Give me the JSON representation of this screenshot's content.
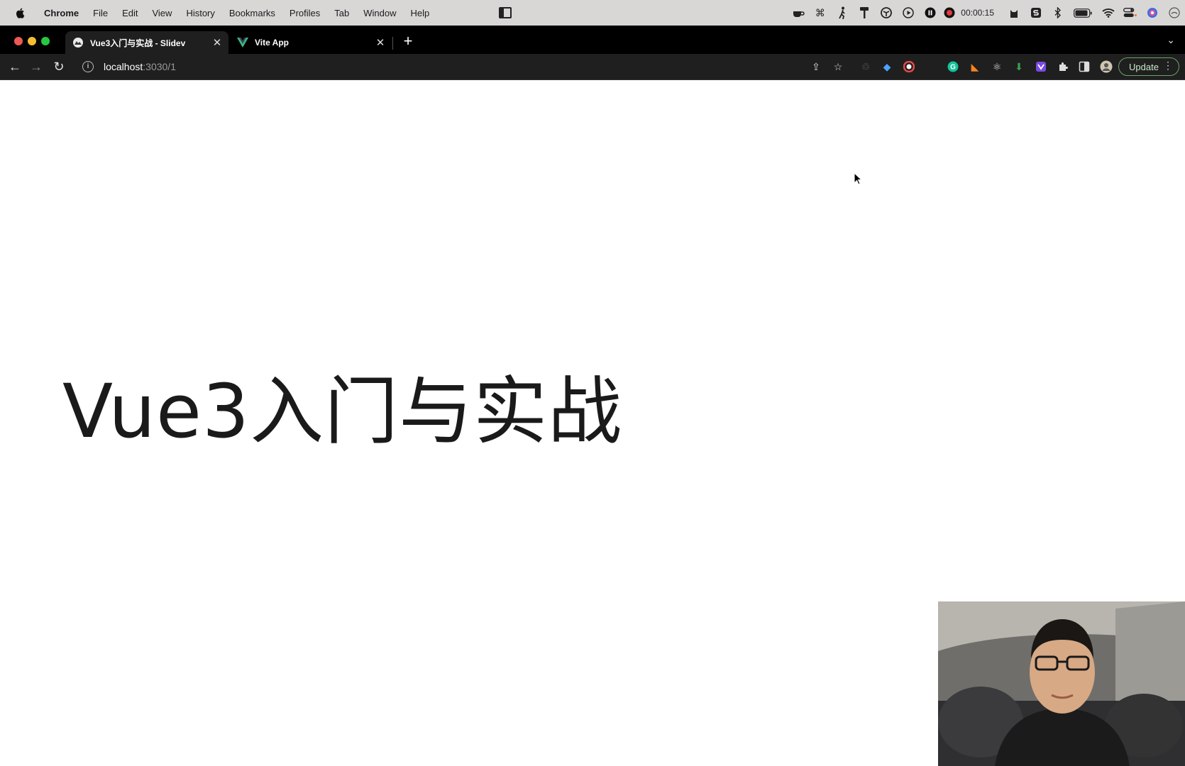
{
  "menubar": {
    "app_name": "Chrome",
    "items": [
      "File",
      "Edit",
      "View",
      "History",
      "Bookmarks",
      "Profiles",
      "Tab",
      "Window",
      "Help"
    ],
    "timer": "00:00:15"
  },
  "tabs": [
    {
      "title": "Vue3入门与实战 - Slidev",
      "active": true,
      "favicon": "slidev-icon"
    },
    {
      "title": "Vite App",
      "active": false,
      "favicon": "vue-icon"
    }
  ],
  "address_bar": {
    "host": "localhost",
    "path": ":3030/1"
  },
  "toolbar": {
    "update_label": "Update"
  },
  "slide": {
    "title": "Vue3入门与实战"
  },
  "colors": {
    "menubar_bg": "#d9d6d6",
    "tabstrip_bg": "#000000",
    "toolbar_bg": "#1f1f1f",
    "update_border": "#6aa36a",
    "slide_text": "#1a1a1a"
  }
}
